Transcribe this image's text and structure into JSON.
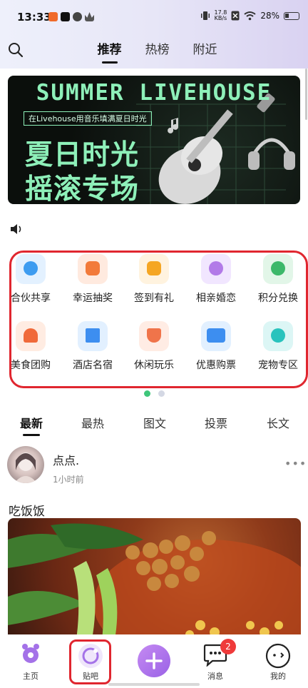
{
  "status_bar": {
    "time": "13:33",
    "net_speed_value": "17.8",
    "net_speed_unit": "KB/s",
    "battery": "28%"
  },
  "header": {
    "tabs": [
      "推荐",
      "热榜",
      "附近"
    ],
    "active_tab": "推荐"
  },
  "banner": {
    "title": "SUMMER LIVEHOUSE",
    "subtitle": "在Livehouse用音乐填满夏日时光",
    "line1": "夏日时光",
    "line2": "摇滚专场"
  },
  "grid": {
    "row1": [
      "合伙共享",
      "幸运抽奖",
      "签到有礼",
      "相亲婚恋",
      "积分兑换"
    ],
    "row2": [
      "美食团购",
      "酒店名宿",
      "休闲玩乐",
      "优惠购票",
      "宠物专区"
    ]
  },
  "feed_tabs": {
    "items": [
      "最新",
      "最热",
      "图文",
      "投票",
      "长文"
    ],
    "active": "最新"
  },
  "post": {
    "username": "点点.",
    "time": "1小时前",
    "title": "吃饭饭"
  },
  "bottom_nav": {
    "items": [
      "主页",
      "贴吧",
      "",
      "消息",
      "我的"
    ],
    "message_badge": "2"
  },
  "colors": {
    "accent": "#a472e8",
    "highlight_border": "#e0262f",
    "badge": "#ef3a3a",
    "banner_text": "#8ef0b9"
  },
  "icons": [
    "search-icon",
    "speaker-icon",
    "more-icon",
    "home-icon",
    "tieba-icon",
    "plus-icon",
    "message-icon",
    "profile-icon"
  ]
}
